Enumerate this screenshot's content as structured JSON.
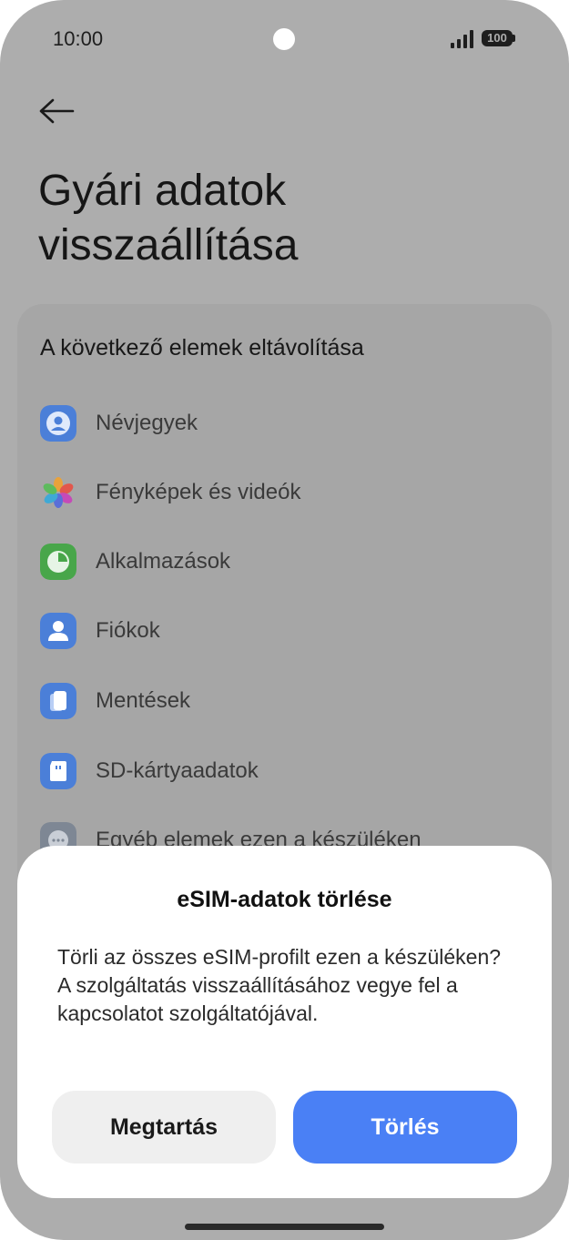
{
  "status_bar": {
    "time": "10:00",
    "battery": "100"
  },
  "page": {
    "title": "Gyári adatok visszaállítása"
  },
  "removal_list": {
    "title": "A következő elemek eltávolítása",
    "items": [
      {
        "label": "Névjegyek",
        "icon": "contacts-icon",
        "color": "#4b7fd8"
      },
      {
        "label": "Fényképek és videók",
        "icon": "photos-icon",
        "color": "#e57d4a"
      },
      {
        "label": "Alkalmazások",
        "icon": "apps-icon",
        "color": "#48a64a"
      },
      {
        "label": "Fiókok",
        "icon": "accounts-icon",
        "color": "#4b7fd8"
      },
      {
        "label": "Mentések",
        "icon": "backups-icon",
        "color": "#4b7fd8"
      },
      {
        "label": "SD-kártyaadatok",
        "icon": "sd-card-icon",
        "color": "#4b7fd8"
      },
      {
        "label": "Egyéb elemek ezen a készüléken",
        "icon": "more-icon",
        "color": "#7e8794"
      }
    ]
  },
  "dialog": {
    "title": "eSIM-adatok törlése",
    "message": "Törli az összes eSIM-profilt ezen a készüléken? A szolgáltatás visszaállításához vegye fel a kapcsolatot szolgáltatójával.",
    "keep_label": "Megtartás",
    "delete_label": "Törlés",
    "accent_color": "#4a80f5"
  }
}
